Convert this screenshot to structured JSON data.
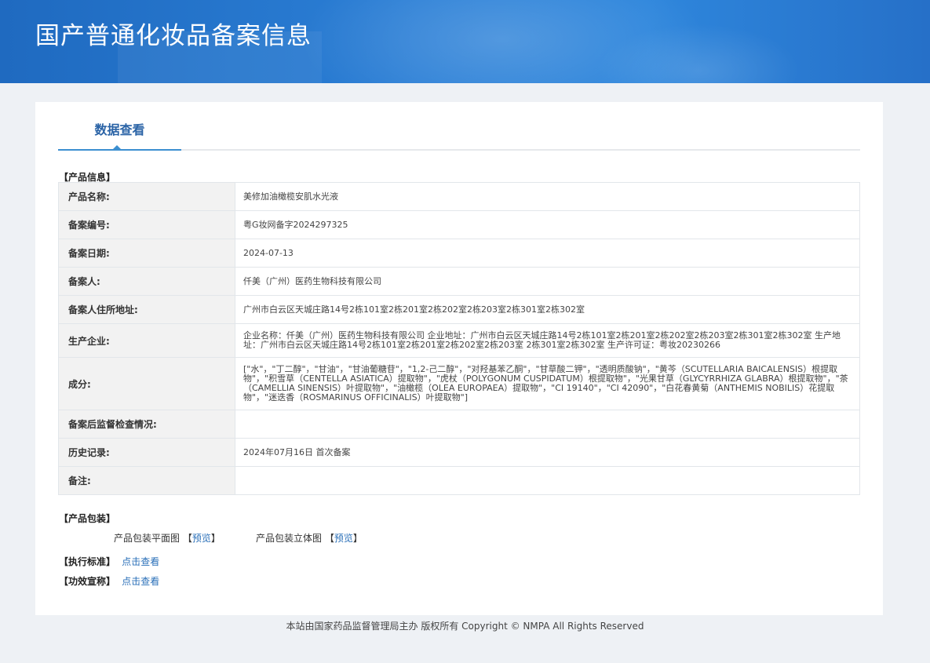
{
  "header": {
    "title": "国产普通化妆品备案信息"
  },
  "tab": {
    "label": "数据查看"
  },
  "product_section": {
    "heading": "【产品信息】"
  },
  "rows": [
    {
      "key": "产品名称:",
      "value": "美修加油橄榄安肌水光液"
    },
    {
      "key": "备案编号:",
      "value": "粤G妆网备字2024297325"
    },
    {
      "key": "备案日期:",
      "value": "2024-07-13"
    },
    {
      "key": "备案人:",
      "value": "仟美（广州）医药生物科技有限公司"
    },
    {
      "key": "备案人住所地址:",
      "value": "广州市白云区天城庄路14号2栋101室2栋201室2栋202室2栋203室2栋301室2栋302室"
    },
    {
      "key": "生产企业:",
      "value": "企业名称：仟美（广州）医药生物科技有限公司 企业地址：广州市白云区天城庄路14号2栋101室2栋201室2栋202室2栋203室2栋301室2栋302室 生产地址：广州市白云区天城庄路14号2栋101室2栋201室2栋202室2栋203室 2栋301室2栋302室 生产许可证：粤妆20230266"
    },
    {
      "key": "成分:",
      "value": "[\"水\"，\"丁二醇\"，\"甘油\"，\"甘油葡糖苷\"，\"1,2-己二醇\"，\"对羟基苯乙酮\"，\"甘草酸二钾\"，\"透明质酸钠\"，\"黄芩（SCUTELLARIA BAICALENSIS）根提取物\"，\"积雪草（CENTELLA ASIATICA）提取物\"，\"虎杖（POLYGONUM CUSPIDATUM）根提取物\"，\"光果甘草（GLYCYRRHIZA GLABRA）根提取物\"，\"茶（CAMELLIA SINENSIS）叶提取物\"，\"油橄榄（OLEA EUROPAEA）提取物\"，\"CI 19140\"，\"CI 42090\"，\"白花春黄菊（ANTHEMIS NOBILIS）花提取物\"，\"迷迭香（ROSMARINUS OFFICINALIS）叶提取物\"]"
    },
    {
      "key": "备案后监督检查情况:",
      "value": ""
    },
    {
      "key": "历史记录:",
      "value": "2024年07月16日 首次备案"
    },
    {
      "key": "备注:",
      "value": ""
    }
  ],
  "package_section": {
    "heading": "【产品包装】",
    "flat_label": "产品包装平面图",
    "solid_label": "产品包装立体图",
    "bracket_open": "【",
    "bracket_close": "】",
    "preview_link": "预览"
  },
  "standard": {
    "label": "【执行标准】",
    "link": "点击查看"
  },
  "efficacy": {
    "label": "【功效宣称】",
    "link": "点击查看"
  },
  "footer": {
    "text": "本站由国家药品监督管理局主办 版权所有 Copyright © NMPA All Rights Reserved"
  }
}
